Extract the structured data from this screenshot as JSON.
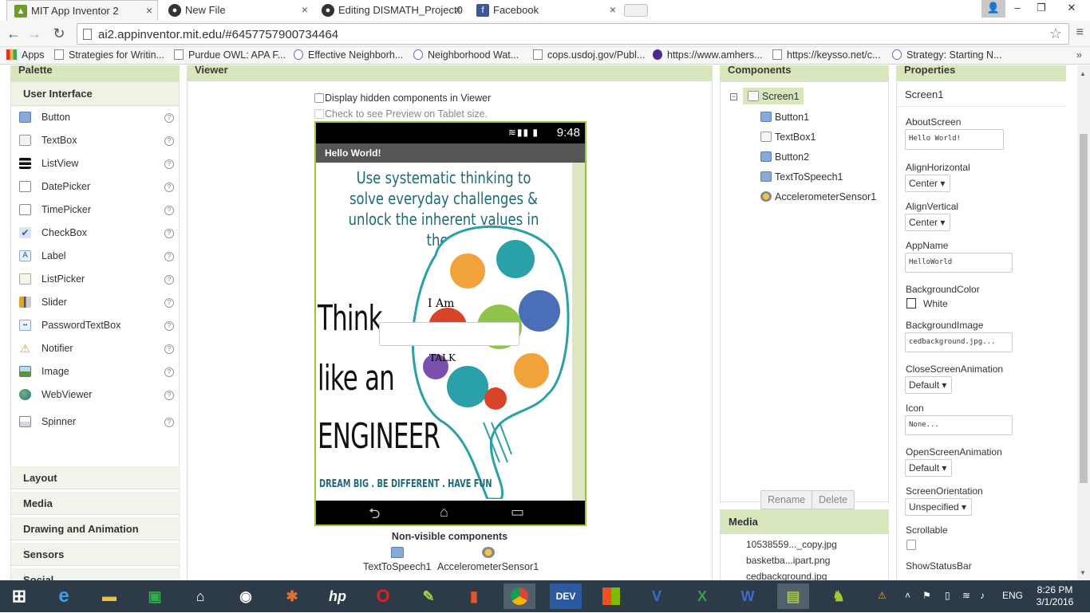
{
  "browser": {
    "tabs": [
      {
        "label": "MIT App Inventor 2",
        "icon": "app-inventor-icon",
        "active": true
      },
      {
        "label": "New File",
        "icon": "github-icon",
        "active": false
      },
      {
        "label": "Editing DISMATH_Project0",
        "icon": "github-icon",
        "active": false
      },
      {
        "label": "Facebook",
        "icon": "facebook-icon",
        "active": false
      }
    ],
    "url": "ai2.appinventor.mit.edu/#6457757900734464",
    "bookmarks": [
      "Apps",
      "Strategies for Writin...",
      "Purdue OWL: APA F...",
      "Effective Neighborh...",
      "Neighborhood Wat...",
      "cops.usdoj.gov/Publ...",
      "https://www.amhers...",
      "https://keysso.net/c...",
      "Strategy: Starting N..."
    ],
    "more": "»"
  },
  "palette": {
    "title": "Palette",
    "open_category": "User Interface",
    "items": [
      {
        "label": "Button",
        "icon": "button-icon"
      },
      {
        "label": "TextBox",
        "icon": "textbox-icon"
      },
      {
        "label": "ListView",
        "icon": "listview-icon"
      },
      {
        "label": "DatePicker",
        "icon": "datepicker-icon"
      },
      {
        "label": "TimePicker",
        "icon": "timepicker-icon"
      },
      {
        "label": "CheckBox",
        "icon": "checkbox-icon"
      },
      {
        "label": "Label",
        "icon": "label-icon"
      },
      {
        "label": "ListPicker",
        "icon": "listpicker-icon"
      },
      {
        "label": "Slider",
        "icon": "slider-icon"
      },
      {
        "label": "PasswordTextBox",
        "icon": "password-icon"
      },
      {
        "label": "Notifier",
        "icon": "notifier-icon"
      },
      {
        "label": "Image",
        "icon": "image-icon"
      },
      {
        "label": "WebViewer",
        "icon": "webviewer-icon"
      },
      {
        "label": "Spinner",
        "icon": "spinner-icon"
      }
    ],
    "help": "?",
    "categories": [
      "Layout",
      "Media",
      "Drawing and Animation",
      "Sensors",
      "Social"
    ]
  },
  "viewer": {
    "title": "Viewer",
    "show_hidden_label": "Display hidden components in Viewer",
    "tablet_preview_label": "Check to see Preview on Tablet size.",
    "phone": {
      "time": "9:48",
      "app_title": "Hello World!",
      "headline": "Use systematic thinking to solve everyday challenges & unlock the inherent values in them",
      "think_lines": [
        "Think",
        "like an",
        "ENGINEER"
      ],
      "tagline": "DREAM BIG . BE DIFFERENT . HAVE FUN",
      "label_text": "I Am",
      "button_text": "TALK"
    },
    "nonvisible_title": "Non-visible components",
    "nonvisible": [
      "TextToSpeech1",
      "AccelerometerSensor1"
    ]
  },
  "components": {
    "title": "Components",
    "tree": [
      "Screen1",
      "Button1",
      "TextBox1",
      "Button2",
      "TextToSpeech1",
      "AccelerometerSensor1"
    ],
    "rename": "Rename",
    "delete": "Delete"
  },
  "media": {
    "title": "Media",
    "files": [
      "10538559..._copy.jpg",
      "basketba...ipart.png",
      "cedbackground.jpg"
    ]
  },
  "properties": {
    "title": "Properties",
    "screen": "Screen1",
    "about_label": "AboutScreen",
    "about_value": "Hello World!",
    "alignh_label": "AlignHorizontal",
    "alignh_value": "Center",
    "alignv_label": "AlignVertical",
    "alignv_value": "Center",
    "appname_label": "AppName",
    "appname_value": "HelloWorld",
    "bgcolor_label": "BackgroundColor",
    "bgcolor_value": "White",
    "bgimage_label": "BackgroundImage",
    "bgimage_value": "cedbackground.jpg...",
    "closeanim_label": "CloseScreenAnimation",
    "closeanim_value": "Default",
    "icon_label": "Icon",
    "icon_value": "None...",
    "openanim_label": "OpenScreenAnimation",
    "openanim_value": "Default",
    "orientation_label": "ScreenOrientation",
    "orientation_value": "Unspecified",
    "scrollable_label": "Scrollable",
    "statusbar_label": "ShowStatusBar"
  },
  "taskbar": {
    "lang": "ENG",
    "time": "8:26 PM",
    "date": "3/1/2016",
    "apps": [
      "windows-start-icon",
      "internet-explorer-icon",
      "file-explorer-icon",
      "store-icon",
      "home-icon",
      "camera-icon",
      "puzzle-icon",
      "hp-icon",
      "opera-icon",
      "notepad-icon",
      "office-icon",
      "chrome-icon",
      "dev-icon",
      "ms-icon",
      "visio-icon",
      "excel-icon",
      "word-icon",
      "android-emulator-icon",
      "android-icon"
    ],
    "app_labels": {
      "hp": "hp",
      "dev": "DEV",
      "visio": "V",
      "excel": "X",
      "word": "W"
    }
  },
  "colors": {
    "panel_header": "#d7e7bb",
    "phone_border": "#9ac43c",
    "taskbar": "#2d3a48"
  }
}
